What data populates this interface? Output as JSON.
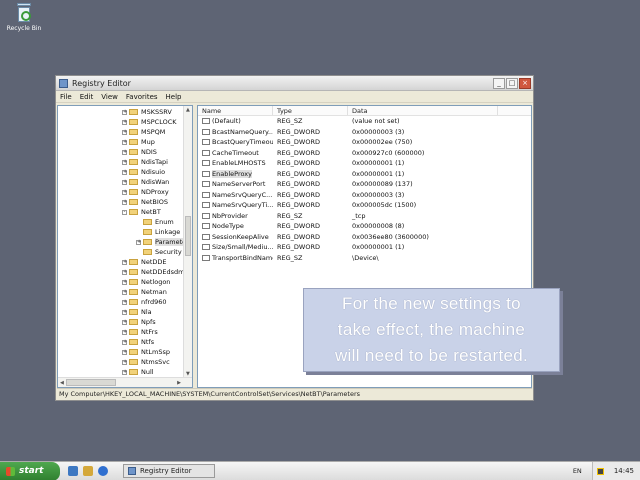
{
  "desktop": {
    "recycle_bin_label": "Recycle Bin"
  },
  "window": {
    "title": "Registry Editor",
    "menu": [
      "File",
      "Edit",
      "View",
      "Favorites",
      "Help"
    ],
    "status_path": "My Computer\\HKEY_LOCAL_MACHINE\\SYSTEM\\CurrentControlSet\\Services\\NetBT\\Parameters"
  },
  "tree": {
    "items": [
      {
        "label": "MSKSSRV",
        "expander": "+"
      },
      {
        "label": "MSPCLOCK",
        "expander": "+"
      },
      {
        "label": "MSPQM",
        "expander": "+"
      },
      {
        "label": "Mup",
        "expander": "+"
      },
      {
        "label": "NDIS",
        "expander": "+"
      },
      {
        "label": "NdisTapi",
        "expander": "+"
      },
      {
        "label": "Ndisuio",
        "expander": "+"
      },
      {
        "label": "NdisWan",
        "expander": "+"
      },
      {
        "label": "NDProxy",
        "expander": "+"
      },
      {
        "label": "NetBIOS",
        "expander": "+"
      },
      {
        "label": "NetBT",
        "expander": "-"
      },
      {
        "label": "Enum",
        "expander": ""
      },
      {
        "label": "Linkage",
        "expander": ""
      },
      {
        "label": "Parameters",
        "expander": "+"
      },
      {
        "label": "Security",
        "expander": ""
      },
      {
        "label": "NetDDE",
        "expander": "+"
      },
      {
        "label": "NetDDEdsdm",
        "expander": "+"
      },
      {
        "label": "Netlogon",
        "expander": "+"
      },
      {
        "label": "Netman",
        "expander": "+"
      },
      {
        "label": "nfrd960",
        "expander": "+"
      },
      {
        "label": "Nla",
        "expander": "+"
      },
      {
        "label": "Npfs",
        "expander": "+"
      },
      {
        "label": "NtFrs",
        "expander": "+"
      },
      {
        "label": "Ntfs",
        "expander": "+"
      },
      {
        "label": "NtLmSsp",
        "expander": "+"
      },
      {
        "label": "NtmsSvc",
        "expander": "+"
      },
      {
        "label": "Null",
        "expander": "+"
      }
    ]
  },
  "list": {
    "headers": {
      "name": "Name",
      "type": "Type",
      "data": "Data"
    },
    "rows": [
      {
        "icon": "ab",
        "name": "(Default)",
        "type": "REG_SZ",
        "data": "(value not set)"
      },
      {
        "icon": "01",
        "name": "BcastNameQuery...",
        "type": "REG_DWORD",
        "data": "0x00000003 (3)"
      },
      {
        "icon": "01",
        "name": "BcastQueryTimeout",
        "type": "REG_DWORD",
        "data": "0x000002ee (750)"
      },
      {
        "icon": "01",
        "name": "CacheTimeout",
        "type": "REG_DWORD",
        "data": "0x000927c0 (600000)"
      },
      {
        "icon": "01",
        "name": "EnableLMHOSTS",
        "type": "REG_DWORD",
        "data": "0x00000001 (1)"
      },
      {
        "icon": "01",
        "name": "EnableProxy",
        "type": "REG_DWORD",
        "data": "0x00000001 (1)"
      },
      {
        "icon": "01",
        "name": "NameServerPort",
        "type": "REG_DWORD",
        "data": "0x00000089 (137)"
      },
      {
        "icon": "01",
        "name": "NameSrvQueryC...",
        "type": "REG_DWORD",
        "data": "0x00000003 (3)"
      },
      {
        "icon": "01",
        "name": "NameSrvQueryTi...",
        "type": "REG_DWORD",
        "data": "0x000005dc (1500)"
      },
      {
        "icon": "ab",
        "name": "NbProvider",
        "type": "REG_SZ",
        "data": "_tcp"
      },
      {
        "icon": "01",
        "name": "NodeType",
        "type": "REG_DWORD",
        "data": "0x00000008 (8)"
      },
      {
        "icon": "01",
        "name": "SessionKeepAlive",
        "type": "REG_DWORD",
        "data": "0x0036ee80 (3600000)"
      },
      {
        "icon": "01",
        "name": "Size/Small/Mediu...",
        "type": "REG_DWORD",
        "data": "0x00000001 (1)"
      },
      {
        "icon": "ab",
        "name": "TransportBindName",
        "type": "REG_SZ",
        "data": "\\Device\\"
      }
    ]
  },
  "callout": {
    "lines": [
      "For the new settings to",
      "take effect, the machine",
      "will need to be restarted."
    ]
  },
  "taskbar": {
    "start_label": "start",
    "task_label": "Registry Editor",
    "language": "EN",
    "clock": "14:45"
  }
}
